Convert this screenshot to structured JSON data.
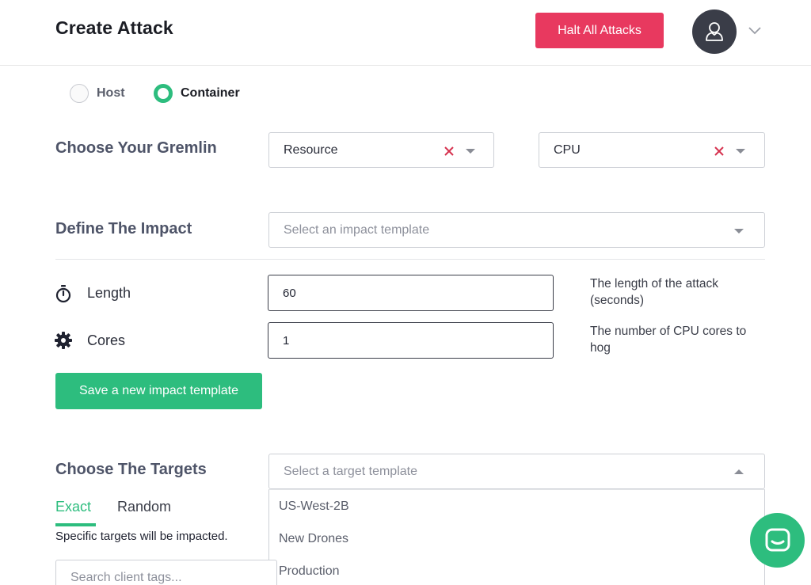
{
  "header": {
    "title": "Create Attack",
    "halt_label": "Halt All Attacks",
    "avatar_icon": "user-icon",
    "menu_icon": "chevron-down-icon"
  },
  "target_type": {
    "options": [
      {
        "label": "Host",
        "selected": false
      },
      {
        "label": "Container",
        "selected": true
      }
    ]
  },
  "gremlin": {
    "title": "Choose Your Gremlin",
    "category": "Resource",
    "type": "CPU"
  },
  "impact": {
    "title": "Define The Impact",
    "template_placeholder": "Select an impact template",
    "params": [
      {
        "label": "Length",
        "icon": "stopwatch-icon",
        "value": "60",
        "help": "The length of the attack (seconds)"
      },
      {
        "label": "Cores",
        "icon": "cog-icon",
        "value": "1",
        "help": "The number of CPU cores to hog"
      }
    ],
    "save_label": "Save a new impact template"
  },
  "targets": {
    "title": "Choose The Targets",
    "tabs": [
      "Exact",
      "Random"
    ],
    "active_tab": "Exact",
    "help": "Specific targets will be impacted.",
    "search_placeholder": "Search client tags...",
    "template_placeholder": "Select a target template",
    "template_options": [
      "US-West-2B",
      "New Drones",
      "Production"
    ]
  },
  "chat_icon": "chat-icon",
  "colors": {
    "accent_green": "#2dbd7e",
    "danger_red": "#e8395f",
    "clear_red": "#d6334f",
    "heading_gray": "#4e5468"
  }
}
